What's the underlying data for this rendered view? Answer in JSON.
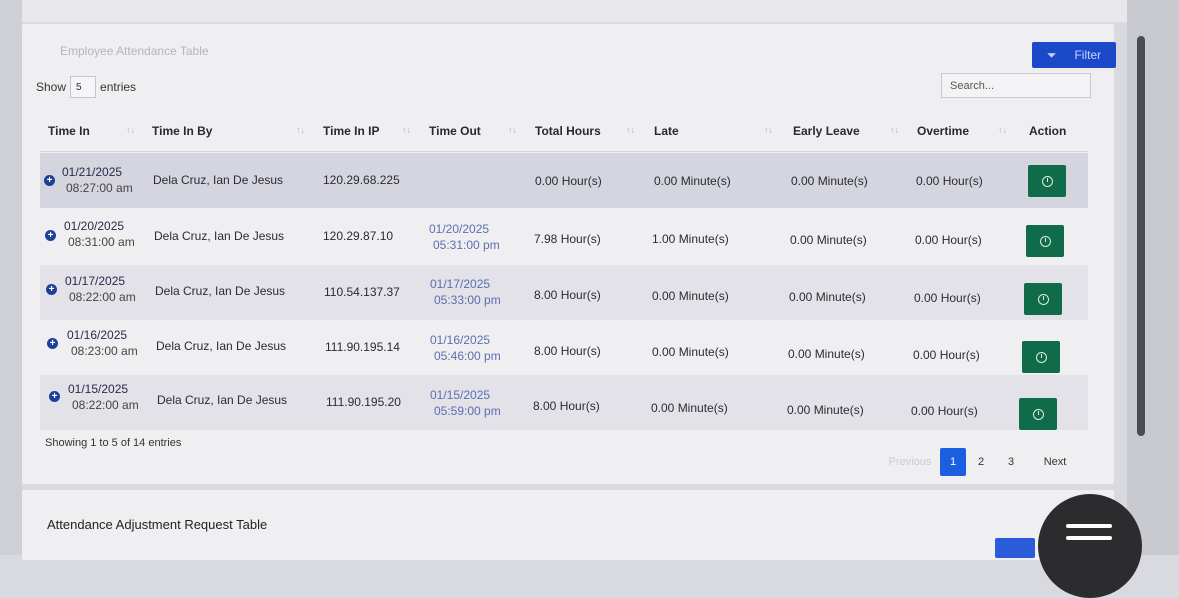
{
  "card": {
    "title_faded": "Employee Attendance Table",
    "filter_label": "Filter"
  },
  "controls": {
    "show_label": "Show",
    "show_value": "5",
    "entries_label": "entries",
    "search_placeholder": "Search..."
  },
  "table": {
    "headers": [
      "Time In",
      "Time In By",
      "Time In IP",
      "Time Out",
      "Total Hours",
      "Late",
      "Early Leave",
      "Overtime",
      "Action"
    ],
    "rows": [
      {
        "time_in_date": "01/21/2025",
        "time_in_time": "08:27:00 am",
        "by": "Dela Cruz, Ian De Jesus",
        "ip": "120.29.68.225",
        "out_date": "",
        "out_time": "",
        "total": "0.00 Hour(s)",
        "late": "0.00 Minute(s)",
        "early": "0.00 Minute(s)",
        "overtime": "0.00 Hour(s)"
      },
      {
        "time_in_date": "01/20/2025",
        "time_in_time": "08:31:00 am",
        "by": "Dela Cruz, Ian De Jesus",
        "ip": "120.29.87.10",
        "out_date": "01/20/2025",
        "out_time": "05:31:00 pm",
        "total": "7.98 Hour(s)",
        "late": "1.00 Minute(s)",
        "early": "0.00 Minute(s)",
        "overtime": "0.00 Hour(s)"
      },
      {
        "time_in_date": "01/17/2025",
        "time_in_time": "08:22:00 am",
        "by": "Dela Cruz, Ian De Jesus",
        "ip": "110.54.137.37",
        "out_date": "01/17/2025",
        "out_time": "05:33:00 pm",
        "total": "8.00 Hour(s)",
        "late": "0.00 Minute(s)",
        "early": "0.00 Minute(s)",
        "overtime": "0.00 Hour(s)"
      },
      {
        "time_in_date": "01/16/2025",
        "time_in_time": "08:23:00 am",
        "by": "Dela Cruz, Ian De Jesus",
        "ip": "111.90.195.14",
        "out_date": "01/16/2025",
        "out_time": "05:46:00 pm",
        "total": "8.00 Hour(s)",
        "late": "0.00 Minute(s)",
        "early": "0.00 Minute(s)",
        "overtime": "0.00 Hour(s)"
      },
      {
        "time_in_date": "01/15/2025",
        "time_in_time": "08:22:00 am",
        "by": "Dela Cruz, Ian De Jesus",
        "ip": "111.90.195.20",
        "out_date": "01/15/2025",
        "out_time": "05:59:00 pm",
        "total": "8.00 Hour(s)",
        "late": "0.00 Minute(s)",
        "early": "0.00 Minute(s)",
        "overtime": "0.00 Hour(s)"
      }
    ]
  },
  "footer": {
    "showing": "Showing 1 to 5 of 14 entries",
    "pager": {
      "previous": "Previous",
      "pages": [
        "1",
        "2",
        "3"
      ],
      "next": "Next"
    }
  },
  "adjustment": {
    "title": "Attendance Adjustment Request Table"
  },
  "colors": {
    "primary": "#1c49c9",
    "action_green": "#0f6b4a",
    "active_page": "#1c5ee0"
  }
}
